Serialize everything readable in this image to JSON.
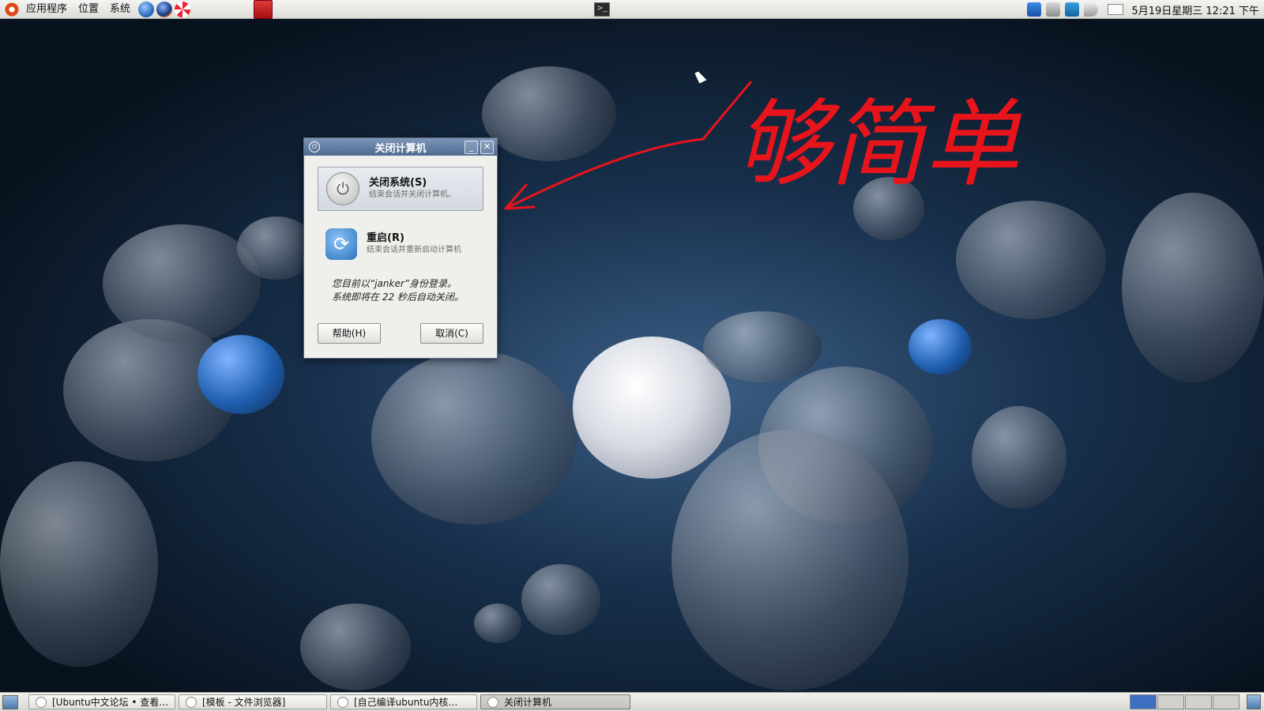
{
  "top_panel": {
    "menus": [
      "应用程序",
      "位置",
      "系统"
    ],
    "clock": "5月19日星期三 12:21 下午"
  },
  "annotation": {
    "handwritten_text": "够简单",
    "color": "#e8141b"
  },
  "dialog": {
    "title": "关闭计算机",
    "minimize": "_",
    "close": "✕",
    "shutdown_title": "关闭系统(S)",
    "shutdown_desc": "结束会话并关闭计算机。",
    "restart_title": "重启(R)",
    "restart_desc": "结束会话并重新启动计算机",
    "info_line1": "您目前以“janker”身份登录。",
    "info_line2": "系统即将在 22 秒后自动关闭。",
    "help_button": "帮助(H)",
    "cancel_button": "取消(C)"
  },
  "taskbar": {
    "tasks": [
      {
        "label": "[Ubuntu中文论坛 • 查看…",
        "active": false
      },
      {
        "label": "[模板 - 文件浏览器]",
        "active": false
      },
      {
        "label": "[自己编译ubuntu内核…",
        "active": false
      },
      {
        "label": "关闭计算机",
        "active": true
      }
    ]
  },
  "colors": {
    "titlebar": "#5c769c",
    "annotation": "#e8141b",
    "workspace_active": "#3d6ebf"
  }
}
